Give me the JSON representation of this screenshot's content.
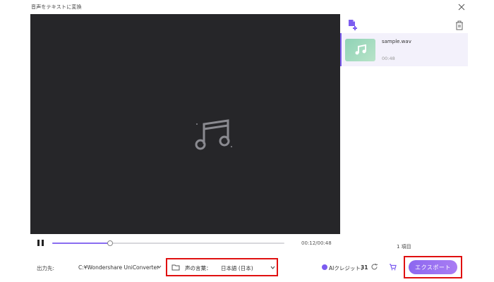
{
  "window": {
    "title": "音声をテキストに変換"
  },
  "player": {
    "current_time": "00:12/00:48",
    "progress": 0.25
  },
  "file_list": {
    "items": [
      {
        "name": "sample.wav",
        "duration": "00:48"
      }
    ],
    "count_label": "1 項目"
  },
  "footer": {
    "output_label": "出力先:",
    "output_path": "C:¥Wondershare UniConverter",
    "language_label": "声の言葉：",
    "language_value": "日本語 (日本)",
    "ai_credit_label": "AIクレジット：",
    "ai_credit_value": "31",
    "export_label": "エクスポート"
  },
  "colors": {
    "accent": "#7c5cf0",
    "highlight_box": "#e01010",
    "player_bg": "#262629"
  }
}
